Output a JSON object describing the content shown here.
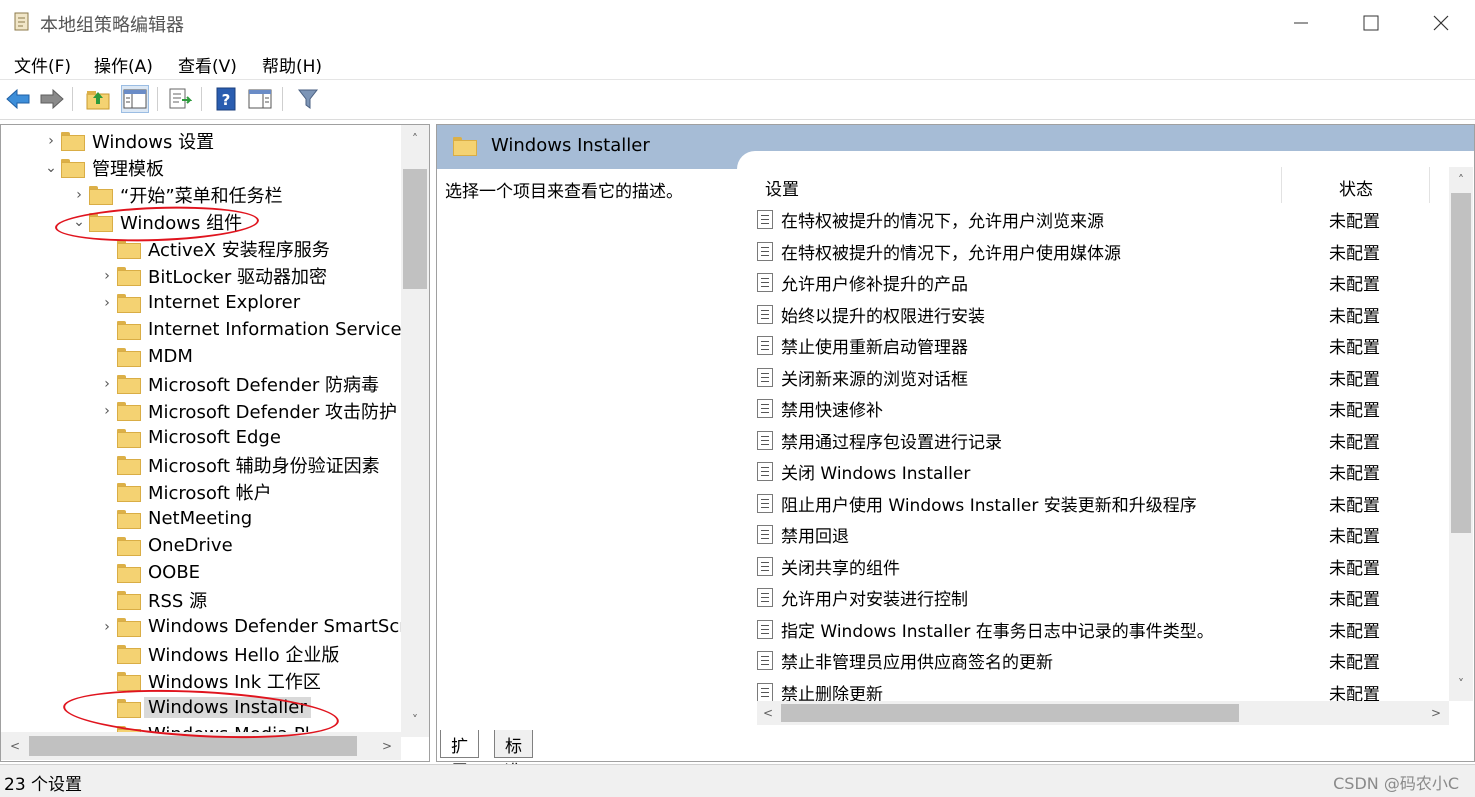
{
  "window": {
    "title": "本地组策略编辑器",
    "min_glyph": "—",
    "max_glyph": "☐",
    "close_glyph": "✕"
  },
  "menu": {
    "file": "文件(F)",
    "action": "操作(A)",
    "view": "查看(V)",
    "help": "帮助(H)"
  },
  "toolbar": {
    "icons": [
      "back-icon",
      "forward-icon",
      "up-folder-icon",
      "show-hide-tree-icon",
      "export-list-icon",
      "help-icon",
      "extended-view-icon",
      "filter-icon"
    ]
  },
  "tree": {
    "items": [
      {
        "label": "Windows 设置",
        "chev": ">"
      },
      {
        "label": "管理模板",
        "chev": "v"
      },
      {
        "label": "“开始”菜单和任务栏",
        "chev": ">"
      },
      {
        "label": "Windows 组件",
        "chev": "v"
      },
      {
        "label": "ActiveX 安装程序服务",
        "chev": ""
      },
      {
        "label": "BitLocker 驱动器加密",
        "chev": ">"
      },
      {
        "label": "Internet Explorer",
        "chev": ">"
      },
      {
        "label": "Internet Information Services",
        "chev": ""
      },
      {
        "label": "MDM",
        "chev": ""
      },
      {
        "label": "Microsoft Defender 防病毒",
        "chev": ">"
      },
      {
        "label": "Microsoft Defender 攻击防护",
        "chev": ">"
      },
      {
        "label": "Microsoft Edge",
        "chev": ""
      },
      {
        "label": "Microsoft 辅助身份验证因素",
        "chev": ""
      },
      {
        "label": "Microsoft 帐户",
        "chev": ""
      },
      {
        "label": "NetMeeting",
        "chev": ""
      },
      {
        "label": "OneDrive",
        "chev": ""
      },
      {
        "label": "OOBE",
        "chev": ""
      },
      {
        "label": "RSS 源",
        "chev": ""
      },
      {
        "label": "Windows Defender SmartScre",
        "chev": ">"
      },
      {
        "label": "Windows Hello 企业版",
        "chev": ""
      },
      {
        "label": "Windows Ink 工作区",
        "chev": ""
      },
      {
        "label": "Windows Installer",
        "chev": ""
      },
      {
        "label": "Windows Media Pl",
        "chev": ""
      }
    ]
  },
  "scroll": {
    "up": "˄",
    "down": "˅",
    "left": "<",
    "right": ">"
  },
  "right": {
    "header_title": "Windows Installer",
    "description": "选择一个项目来查看它的描述。",
    "col_setting": "设置",
    "col_status": "状态",
    "rows": [
      {
        "name": "在特权被提升的情况下，允许用户浏览来源",
        "status": "未配置"
      },
      {
        "name": "在特权被提升的情况下，允许用户使用媒体源",
        "status": "未配置"
      },
      {
        "name": "允许用户修补提升的产品",
        "status": "未配置"
      },
      {
        "name": "始终以提升的权限进行安装",
        "status": "未配置"
      },
      {
        "name": "禁止使用重新启动管理器",
        "status": "未配置"
      },
      {
        "name": "关闭新来源的浏览对话框",
        "status": "未配置"
      },
      {
        "name": "禁用快速修补",
        "status": "未配置"
      },
      {
        "name": "禁用通过程序包设置进行记录",
        "status": "未配置"
      },
      {
        "name": "关闭 Windows Installer",
        "status": "未配置"
      },
      {
        "name": "阻止用户使用 Windows Installer 安装更新和升级程序",
        "status": "未配置"
      },
      {
        "name": "禁用回退",
        "status": "未配置"
      },
      {
        "name": "关闭共享的组件",
        "status": "未配置"
      },
      {
        "name": "允许用户对安装进行控制",
        "status": "未配置"
      },
      {
        "name": "指定 Windows Installer 在事务日志中记录的事件类型。",
        "status": "未配置"
      },
      {
        "name": "禁止非管理员应用供应商签名的更新",
        "status": "未配置"
      },
      {
        "name": "禁止删除更新",
        "status": "未配置"
      }
    ]
  },
  "tabs": {
    "extended": "扩展",
    "standard": "标准"
  },
  "status": {
    "text": "23 个设置",
    "watermark": "CSDN @码农小C"
  },
  "colors": {
    "header_bg": "#a6bcd6",
    "selection": "#d9d9d9",
    "annotation": "#e0141e",
    "folder": "#f4d272"
  }
}
